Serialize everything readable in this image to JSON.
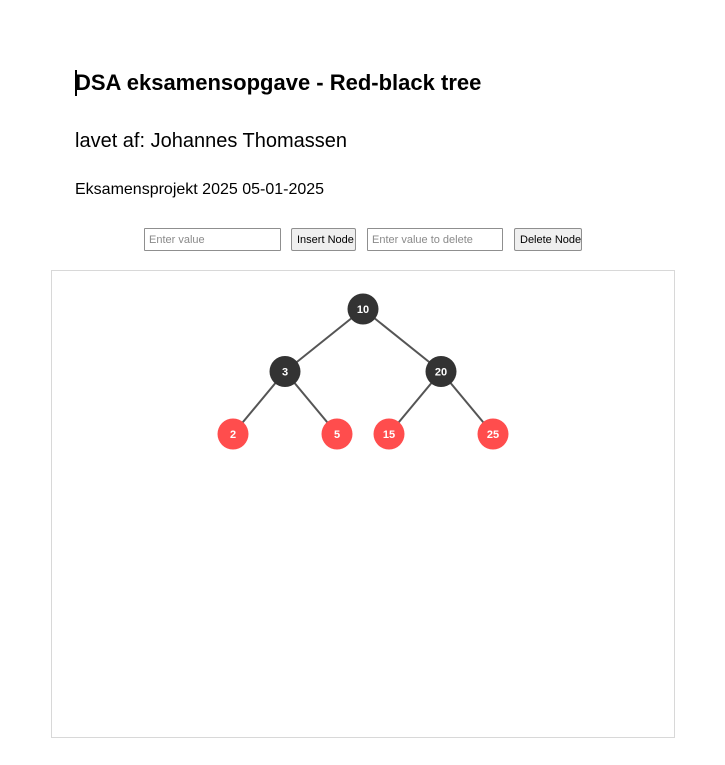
{
  "header": {
    "title": "DSA eksamensopgave - Red-black tree",
    "author": "lavet af: Johannes Thomassen",
    "subtitle": "Eksamensprojekt 2025 05-01-2025"
  },
  "controls": {
    "insert_placeholder": "Enter value",
    "insert_value": "",
    "insert_button": "Insert Node",
    "delete_placeholder": "Enter value to delete",
    "delete_value": "",
    "delete_button": "Delete Node"
  },
  "tree": {
    "colors": {
      "black": "#333333",
      "red": "#ff4d4d",
      "edge": "#555555",
      "label": "#ffffff"
    },
    "root": {
      "value": "10",
      "color": "black",
      "left": {
        "value": "3",
        "color": "black",
        "left": {
          "value": "2",
          "color": "red"
        },
        "right": {
          "value": "5",
          "color": "red"
        }
      },
      "right": {
        "value": "20",
        "color": "black",
        "left": {
          "value": "15",
          "color": "red"
        },
        "right": {
          "value": "25",
          "color": "red"
        }
      }
    }
  }
}
